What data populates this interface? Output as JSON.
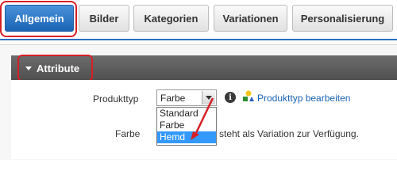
{
  "tabs": [
    {
      "label": "Allgemein",
      "active": true
    },
    {
      "label": "Bilder",
      "active": false
    },
    {
      "label": "Kategorien",
      "active": false
    },
    {
      "label": "Variationen",
      "active": false
    },
    {
      "label": "Personalisierung",
      "active": false
    }
  ],
  "section": {
    "title": "Attribute"
  },
  "form": {
    "producttype_label": "Produkttyp",
    "select_value": "Farbe",
    "options": [
      "Standard",
      "Farbe",
      "Hemd"
    ],
    "selected_option": "Hemd",
    "edit_link": "Produkttyp bearbeiten",
    "color_label": "Farbe",
    "color_note": "steht als Variation zur Verfügung."
  },
  "icons": {
    "info": "info-icon",
    "shapes": "shapes-icon",
    "dropdown_arrow": "chevron-down-icon",
    "section_toggle": "triangle-down-icon"
  },
  "colors": {
    "accent": "#1a63b5",
    "highlight": "#d71f26",
    "selected_option": "#3399ff",
    "section_bar": "#5c5c5c"
  }
}
